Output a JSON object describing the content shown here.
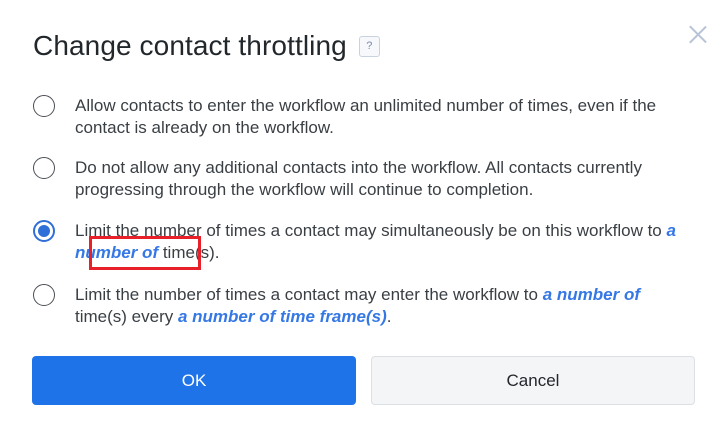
{
  "dialog": {
    "title": "Change contact throttling",
    "help_label": "?",
    "close_icon": "close-icon"
  },
  "options": [
    {
      "selected": false,
      "text": "Allow contacts to enter the workflow an unlimited number of times, even if the contact is already on the workflow."
    },
    {
      "selected": false,
      "text": "Do not allow any additional contacts into the workflow. All contacts currently progressing through the workflow will continue to completion."
    },
    {
      "selected": true,
      "text_before": "Limit the number of times a contact may simultaneously be on this workflow to ",
      "link": "a number of",
      "text_after": " time(s)."
    },
    {
      "selected": false,
      "text_before": "Limit the number of times a contact may enter the workflow to ",
      "link1": "a number of",
      "text_mid": " time(s) every ",
      "link2": "a number of time frame(s)",
      "text_after": "."
    }
  ],
  "buttons": {
    "ok": "OK",
    "cancel": "Cancel"
  },
  "colors": {
    "accent": "#1f73e8",
    "link": "#3578e5",
    "highlight_box": "#e8202a"
  }
}
